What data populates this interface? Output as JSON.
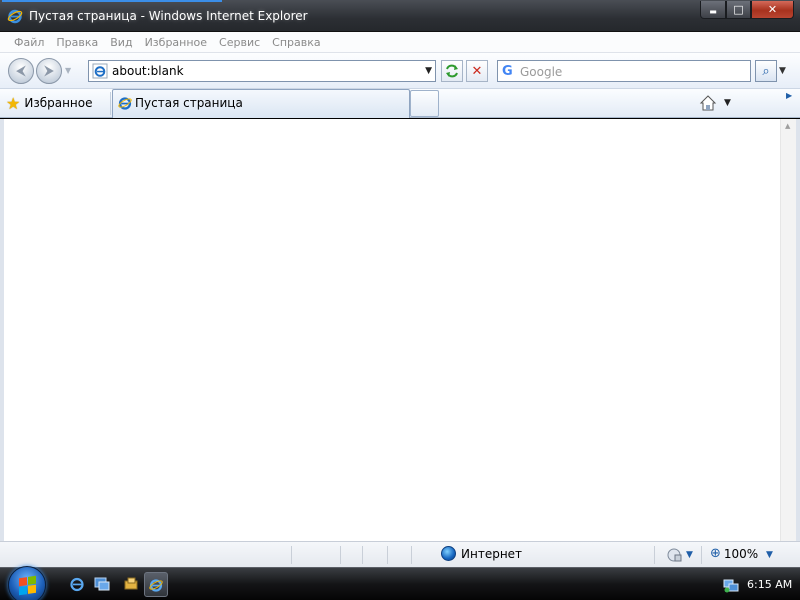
{
  "window": {
    "title": "Пустая страница - Windows Internet Explorer",
    "min_glyph": "▬",
    "max_glyph": "□",
    "close_glyph": "✕"
  },
  "menubar": {
    "items": [
      "Файл",
      "Правка",
      "Вид",
      "Избранное",
      "Сервис",
      "Справка"
    ]
  },
  "navbar": {
    "back_glyph": "⮜",
    "forward_glyph": "⮞",
    "address_value": "about:blank",
    "search_placeholder": "Google",
    "search_engine_glyph": "G",
    "search_go_glyph": "⌕",
    "stop_glyph": "✕"
  },
  "favorites_bar": {
    "favorites_label": "Избранное",
    "tab_label": "Пустая страница"
  },
  "statusbar": {
    "zone_label": "Интернет",
    "zoom_label": "100%"
  },
  "taskbar": {
    "clock": "6:15 AM"
  },
  "colors": {
    "ie_blue": "#1f6fc5",
    "ie_gold": "#f2b705",
    "titlebar": "#2c2f34",
    "close_red": "#b94532"
  },
  "icons": {
    "browser": "internet-explorer-icon",
    "favorites": "star-icon",
    "home": "home-icon",
    "zone": "globe-icon",
    "zoom": "magnifier-icon",
    "protected_mode": "shield-lock-icon",
    "network": "network-icon"
  }
}
